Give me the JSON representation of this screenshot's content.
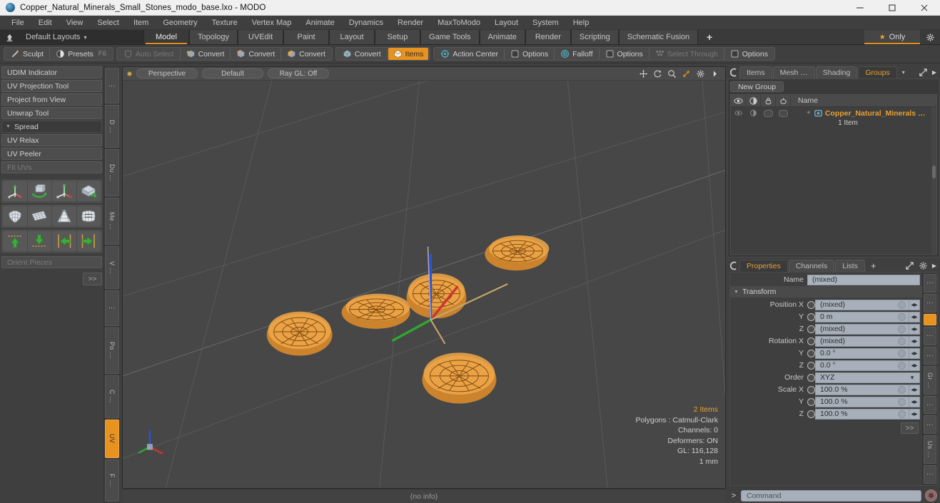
{
  "window": {
    "title": "Copper_Natural_Minerals_Small_Stones_modo_base.lxo - MODO",
    "minimize": "—",
    "maximize": "□",
    "close": "✕"
  },
  "menubar": {
    "items": [
      "File",
      "Edit",
      "View",
      "Select",
      "Item",
      "Geometry",
      "Texture",
      "Vertex Map",
      "Animate",
      "Dynamics",
      "Render",
      "MaxToModo",
      "Layout",
      "System",
      "Help"
    ]
  },
  "layoutbar": {
    "default_layouts": "Default Layouts",
    "caret": "▾",
    "tabs": [
      {
        "label": "Model",
        "active": true
      },
      {
        "label": "Topology",
        "active": false
      },
      {
        "label": "UVEdit",
        "active": false
      },
      {
        "label": "Paint",
        "active": false
      },
      {
        "label": "Layout",
        "active": false
      },
      {
        "label": "Setup",
        "active": false
      },
      {
        "label": "Game Tools",
        "active": false
      },
      {
        "label": "Animate",
        "active": false
      },
      {
        "label": "Render",
        "active": false
      },
      {
        "label": "Scripting",
        "active": false
      },
      {
        "label": "Schematic Fusion",
        "active": false
      }
    ],
    "add": "+",
    "only": "Only",
    "star": "★"
  },
  "toolbar": {
    "left_group": [
      {
        "label": "Sculpt",
        "icon": "brush-icon",
        "dim": false,
        "active": false,
        "key": ""
      },
      {
        "label": "Presets",
        "icon": "sphere-icon",
        "dim": false,
        "active": false,
        "key": "F6"
      }
    ],
    "main_group": [
      {
        "label": "Auto Select",
        "icon": "shield-icon",
        "dim": true,
        "active": false
      },
      {
        "label": "Convert",
        "icon": "cube-vertex-icon",
        "dim": false,
        "active": false
      },
      {
        "label": "Convert",
        "icon": "cube-edge-icon",
        "dim": false,
        "active": false
      },
      {
        "label": "Convert",
        "icon": "cube-poly-icon",
        "dim": false,
        "active": false
      }
    ],
    "items_group": [
      {
        "label": "Convert",
        "icon": "cube-icon",
        "dim": false,
        "active": false
      },
      {
        "label": "Items",
        "icon": "items-icon",
        "dim": false,
        "active": true
      }
    ],
    "right_group": [
      {
        "label": "Action Center",
        "icon": "action-center-icon",
        "dim": false
      },
      {
        "label": "Options",
        "icon": "square-icon",
        "dim": false
      },
      {
        "label": "Falloff",
        "icon": "falloff-icon",
        "dim": false
      },
      {
        "label": "Options",
        "icon": "square-icon",
        "dim": false
      },
      {
        "label": "Select Through",
        "icon": "select-through-icon",
        "dim": true
      },
      {
        "label": "Options",
        "icon": "square-icon",
        "dim": false
      }
    ]
  },
  "left_panel": {
    "buttons": [
      {
        "label": "UDIM Indicator",
        "type": "button",
        "dim": false
      },
      {
        "label": "UV Projection Tool",
        "type": "button",
        "dim": false
      },
      {
        "label": "Project from View",
        "type": "button",
        "dim": false
      },
      {
        "label": "Unwrap Tool",
        "type": "button",
        "dim": false
      },
      {
        "label": "Spread",
        "type": "group",
        "dim": false
      },
      {
        "label": "UV Relax",
        "type": "button",
        "dim": false
      },
      {
        "label": "UV Peeler",
        "type": "button",
        "dim": false
      },
      {
        "label": "Fit UVs",
        "type": "button",
        "dim": true
      }
    ],
    "icon_rows": [
      [
        "uv-move-icon",
        "uv-rotate-icon",
        "uv-scale-icon",
        "uv-flip-icon"
      ],
      [
        "uv-fit-icon",
        "uv-grid-icon",
        "uv-cone-icon",
        "uv-cube-icon"
      ],
      [
        "align-up-icon",
        "align-down-icon",
        "align-left-icon",
        "align-right-icon"
      ]
    ],
    "orient_pieces": "Orient Pieces",
    "more_button": ">>",
    "vtabs": [
      {
        "label": "⋮",
        "active": false
      },
      {
        "label": "D …",
        "active": false
      },
      {
        "label": "Du …",
        "active": false
      },
      {
        "label": "Me …",
        "active": false
      },
      {
        "label": "V …",
        "active": false
      },
      {
        "label": "⋮",
        "active": false
      },
      {
        "label": "Po …",
        "active": false
      },
      {
        "label": "C …",
        "active": false
      },
      {
        "label": "UV",
        "active": true
      },
      {
        "label": "F …",
        "active": false
      }
    ]
  },
  "viewport": {
    "mode": "Perspective",
    "shading": "Default",
    "raygl": "Ray GL: Off",
    "nav_icons": [
      "pan-icon",
      "rotate-icon",
      "zoom-icon",
      "fit-icon",
      "gear-icon",
      "chevron-right-icon"
    ],
    "info": {
      "items": "2 Items",
      "polygons": "Polygons : Catmull-Clark",
      "channels": "Channels: 0",
      "deformers": "Deformers: ON",
      "gl": "GL: 116,128",
      "scale": "1 mm"
    },
    "status": "(no info)"
  },
  "right_panel": {
    "top_tabs": [
      {
        "label": "Items",
        "active": false
      },
      {
        "label": "Mesh …",
        "active": false
      },
      {
        "label": "Shading",
        "active": false
      },
      {
        "label": "Groups",
        "active": true
      }
    ],
    "top_caret": "▾",
    "new_group": "New Group",
    "list_header": {
      "name": "Name",
      "cols": [
        "eye-icon",
        "render-icon",
        "lock-icon",
        "select-icon"
      ]
    },
    "list_rows": [
      {
        "name": "Copper_Natural_Minerals …",
        "sub": "1 Item",
        "plus": "+"
      }
    ],
    "prop_tabs": [
      {
        "label": "Properties",
        "active": true
      },
      {
        "label": "Channels",
        "active": false
      },
      {
        "label": "Lists",
        "active": false
      },
      {
        "label": "+",
        "active": false
      }
    ],
    "properties": {
      "name_label": "Name",
      "name_value": "(mixed)",
      "section": "Transform",
      "rows": [
        {
          "label": "Position X",
          "value": "(mixed)",
          "kind": "spin"
        },
        {
          "label": "Y",
          "value": "0 m",
          "kind": "spin"
        },
        {
          "label": "Z",
          "value": "(mixed)",
          "kind": "spin"
        },
        {
          "label": "Rotation X",
          "value": "(mixed)",
          "kind": "spin"
        },
        {
          "label": "Y",
          "value": "0.0 °",
          "kind": "spin"
        },
        {
          "label": "Z",
          "value": "0.0 °",
          "kind": "spin"
        },
        {
          "label": "Order",
          "value": "XYZ",
          "kind": "dropdown"
        },
        {
          "label": "Scale X",
          "value": "100.0 %",
          "kind": "spin"
        },
        {
          "label": "Y",
          "value": "100.0 %",
          "kind": "spin"
        },
        {
          "label": "Z",
          "value": "100.0 %",
          "kind": "spin"
        }
      ],
      "more_button": ">>"
    },
    "vtabs": [
      {
        "label": "⋮",
        "active": false
      },
      {
        "label": "⋮",
        "active": false
      },
      {
        "label": "",
        "active": true
      },
      {
        "label": "⋮",
        "active": false
      },
      {
        "label": "⋮",
        "active": false
      },
      {
        "label": "Gr …",
        "active": false
      },
      {
        "label": "⋮",
        "active": false
      },
      {
        "label": "⋮",
        "active": false
      },
      {
        "label": "Us …",
        "active": false
      },
      {
        "label": "⋮",
        "active": false
      }
    ],
    "command": {
      "prefix": ">",
      "placeholder": "Command",
      "record": "record-icon"
    }
  },
  "colors": {
    "accent": "#e8921f",
    "mesh_wire": "#e8943a",
    "viewport_bg": "#474747",
    "panel_bg": "#3f3f3f",
    "axis_x": "#cc3333",
    "axis_y": "#2a52d8",
    "axis_z": "#2fa82f"
  }
}
